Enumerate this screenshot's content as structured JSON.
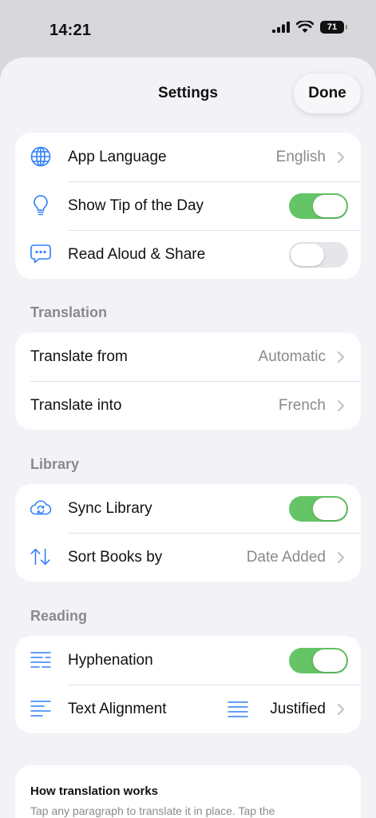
{
  "status_bar": {
    "time": "14:21",
    "battery": "71"
  },
  "header": {
    "title": "Settings",
    "done_label": "Done"
  },
  "colors": {
    "accent": "#2f7ff7",
    "toggle_on": "#65c466",
    "toggle_off": "#e5e5ea",
    "secondary_text": "#8a8a8e",
    "sheet_bg": "#f2f2f7"
  },
  "general": {
    "app_language": {
      "label": "App Language",
      "value": "English",
      "icon": "globe-icon"
    },
    "tip_of_day": {
      "label": "Show Tip of the Day",
      "enabled": true,
      "icon": "lightbulb-icon"
    },
    "read_aloud": {
      "label": "Read Aloud & Share",
      "enabled": false,
      "icon": "speech-bubble-icon"
    }
  },
  "translation": {
    "header": "Translation",
    "from": {
      "label": "Translate from",
      "value": "Automatic"
    },
    "into": {
      "label": "Translate into",
      "value": "French"
    }
  },
  "library": {
    "header": "Library",
    "sync": {
      "label": "Sync Library",
      "enabled": true,
      "icon": "cloud-sync-icon"
    },
    "sort": {
      "label": "Sort Books by",
      "value": "Date Added",
      "icon": "sort-arrows-icon"
    }
  },
  "reading": {
    "header": "Reading",
    "hyphenation": {
      "label": "Hyphenation",
      "enabled": true,
      "icon": "hyphenation-icon"
    },
    "alignment": {
      "label": "Text Alignment",
      "value": "Justified",
      "icon": "text-align-icon",
      "value_icon": "justify-icon"
    }
  },
  "info": {
    "title": "How translation works",
    "text": "Tap any paragraph to translate it in place. Tap the"
  }
}
